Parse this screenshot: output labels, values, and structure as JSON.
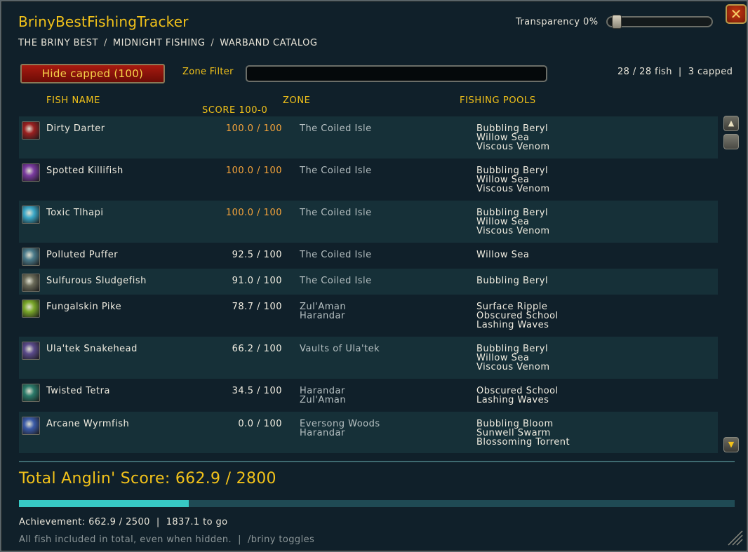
{
  "window": {
    "title": "BrinyBestFishingTracker",
    "breadcrumb": [
      "THE BRINY BEST",
      "MIDNIGHT FISHING",
      "WARBAND CATALOG"
    ],
    "breadcrumb_sep": "/",
    "close_label": "✕",
    "transparency_label": "Transparency 0%",
    "transparency_value": 0
  },
  "toolbar": {
    "hide_capped_label": "Hide capped (100)",
    "zone_filter_label": "Zone Filter",
    "zone_filter_value": "",
    "summary": "28 / 28 fish  |  3 capped"
  },
  "columns": {
    "fish_name": "FISH NAME",
    "score": "SCORE 100-0",
    "zone": "ZONE",
    "pools": "FISHING POOLS"
  },
  "rows": [
    {
      "name": "Dirty Darter",
      "score": "100.0 / 100",
      "capped": true,
      "zones": [
        "The Coiled Isle"
      ],
      "pools": [
        "Bubbling Beryl",
        "Willow Sea",
        "Viscous Venom"
      ],
      "icon": "dirty-darter-icon",
      "icon_color": "#9a2020"
    },
    {
      "name": "Spotted Killifish",
      "score": "100.0 / 100",
      "capped": true,
      "zones": [
        "The Coiled Isle"
      ],
      "pools": [
        "Bubbling Beryl",
        "Willow Sea",
        "Viscous Venom"
      ],
      "icon": "spotted-killifish-icon",
      "icon_color": "#7a3aa0"
    },
    {
      "name": "Toxic Tlhapi",
      "score": "100.0 / 100",
      "capped": true,
      "zones": [
        "The Coiled Isle"
      ],
      "pools": [
        "Bubbling Beryl",
        "Willow Sea",
        "Viscous Venom"
      ],
      "icon": "toxic-tlhapi-icon",
      "icon_color": "#3aa8c8"
    },
    {
      "name": "Polluted Puffer",
      "score": "92.5 / 100",
      "capped": false,
      "zones": [
        "The Coiled Isle"
      ],
      "pools": [
        "Willow Sea"
      ],
      "icon": "polluted-puffer-icon",
      "icon_color": "#4a7a8a"
    },
    {
      "name": "Sulfurous Sludgefish",
      "score": "91.0 / 100",
      "capped": false,
      "zones": [
        "The Coiled Isle"
      ],
      "pools": [
        "Bubbling Beryl"
      ],
      "icon": "sulfurous-sludgefish-icon",
      "icon_color": "#6a6a58"
    },
    {
      "name": "Fungalskin Pike",
      "score": "78.7 / 100",
      "capped": false,
      "zones": [
        "Zul'Aman",
        "Harandar"
      ],
      "pools": [
        "Surface Ripple",
        "Obscured School",
        "Lashing Waves"
      ],
      "icon": "fungalskin-pike-icon",
      "icon_color": "#7aa82a"
    },
    {
      "name": "Ula'tek Snakehead",
      "score": "66.2 / 100",
      "capped": false,
      "zones": [
        "Vaults of Ula'tek"
      ],
      "pools": [
        "Bubbling Beryl",
        "Willow Sea",
        "Viscous Venom"
      ],
      "icon": "ulatek-snakehead-icon",
      "icon_color": "#5a4a8a"
    },
    {
      "name": "Twisted Tetra",
      "score": "34.5 / 100",
      "capped": false,
      "zones": [
        "Harandar",
        "Zul'Aman"
      ],
      "pools": [
        "Obscured School",
        "Lashing Waves"
      ],
      "icon": "twisted-tetra-icon",
      "icon_color": "#2a7a6a"
    },
    {
      "name": "Arcane Wyrmfish",
      "score": "0.0 / 100",
      "capped": false,
      "zones": [
        "Eversong Woods",
        "Harandar"
      ],
      "pools": [
        "Bubbling Bloom",
        "Sunwell Swarm",
        "Blossoming Torrent"
      ],
      "icon": "arcane-wyrmfish-icon",
      "icon_color": "#3a5aa8"
    }
  ],
  "totals": {
    "total_label": "Total Anglin' Score: 662.9 / 2800",
    "progress_fraction": 0.2368,
    "achievement": "Achievement: 662.9 / 2500  |  1837.1 to go",
    "footer": "All fish included in total, even when hidden.  |  /briny toggles"
  },
  "colors": {
    "accent_gold": "#f2c21a",
    "capped_orange": "#f5a33a",
    "progress_teal": "#37c8c4",
    "button_red": "#a81a10"
  }
}
